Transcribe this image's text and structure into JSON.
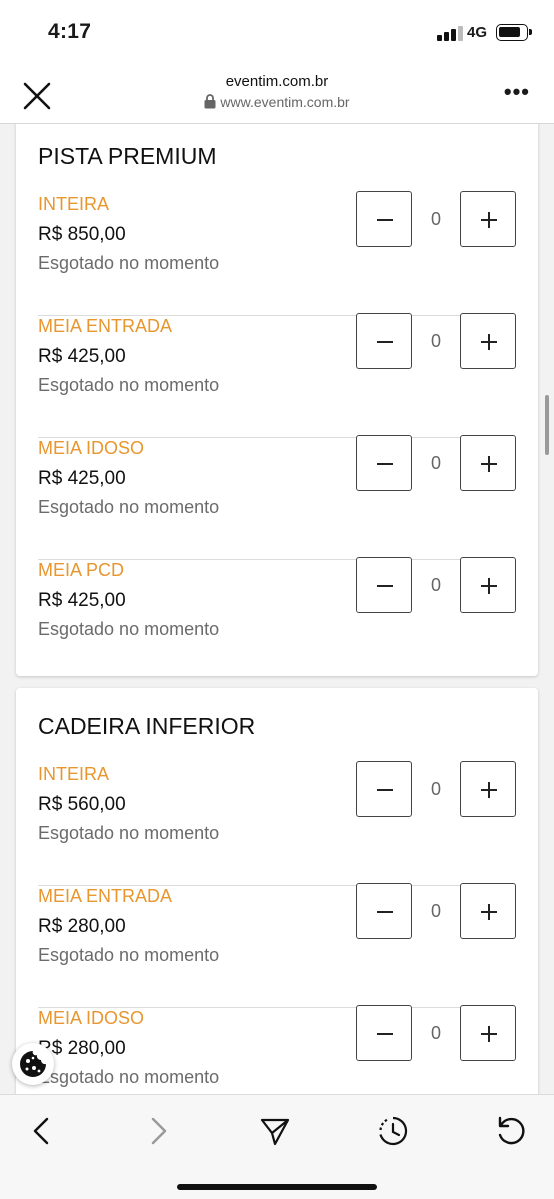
{
  "status_bar": {
    "time": "4:17",
    "network": "4G"
  },
  "browser": {
    "title": "eventim.com.br",
    "url": "www.eventim.com.br"
  },
  "sections": [
    {
      "title": "PISTA PREMIUM",
      "tickets": [
        {
          "name": "INTEIRA",
          "price": "R$ 850,00",
          "status": "Esgotado no momento",
          "quantity": "0"
        },
        {
          "name": "MEIA ENTRADA",
          "price": "R$ 425,00",
          "status": "Esgotado no momento",
          "quantity": "0"
        },
        {
          "name": "MEIA IDOSO",
          "price": "R$ 425,00",
          "status": "Esgotado no momento",
          "quantity": "0"
        },
        {
          "name": "MEIA PCD",
          "price": "R$ 425,00",
          "status": "Esgotado no momento",
          "quantity": "0"
        }
      ]
    },
    {
      "title": "CADEIRA INFERIOR",
      "tickets": [
        {
          "name": "INTEIRA",
          "price": "R$ 560,00",
          "status": "Esgotado no momento",
          "quantity": "0"
        },
        {
          "name": "MEIA ENTRADA",
          "price": "R$ 280,00",
          "status": "Esgotado no momento",
          "quantity": "0"
        },
        {
          "name": "MEIA IDOSO",
          "price": "R$ 280,00",
          "status": "Esgotado no momento",
          "quantity": "0"
        }
      ]
    }
  ],
  "icons": {
    "close": "close-icon",
    "lock": "lock-icon",
    "more": "more-icon",
    "minus": "minus-icon",
    "plus": "plus-icon",
    "cookie": "cookie-icon",
    "back": "chevron-left-icon",
    "forward": "chevron-right-icon",
    "share": "send-icon",
    "history": "history-icon",
    "reload": "reload-icon"
  },
  "colors": {
    "ticket_name": "#e8962e",
    "status_text": "#6b6b6b"
  }
}
